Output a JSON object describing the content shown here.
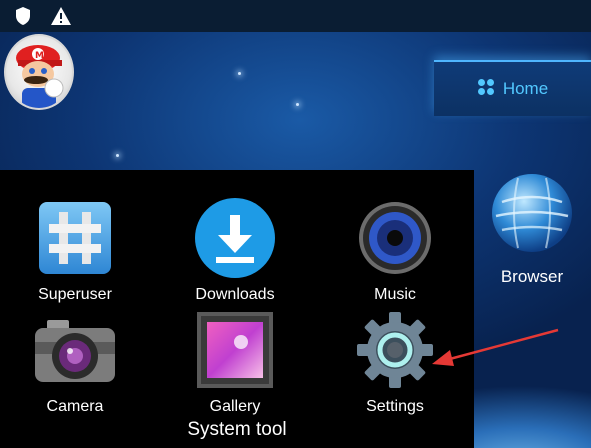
{
  "status_bar": {
    "icons": [
      "shield-icon",
      "warning-icon"
    ]
  },
  "home": {
    "label": "Home",
    "icon": "grid-icon",
    "accent": "#52c8ff"
  },
  "browser": {
    "label": "Browser",
    "icon": "globe-icon"
  },
  "folder": {
    "title": "System tool",
    "apps": [
      {
        "label": "Superuser",
        "icon": "hash-icon"
      },
      {
        "label": "Downloads",
        "icon": "download-icon"
      },
      {
        "label": "Music",
        "icon": "speaker-icon"
      },
      {
        "label": "Camera",
        "icon": "camera-icon"
      },
      {
        "label": "Gallery",
        "icon": "gallery-icon"
      },
      {
        "label": "Settings",
        "icon": "gear-icon"
      }
    ]
  },
  "annotation": {
    "color": "#e53935"
  }
}
